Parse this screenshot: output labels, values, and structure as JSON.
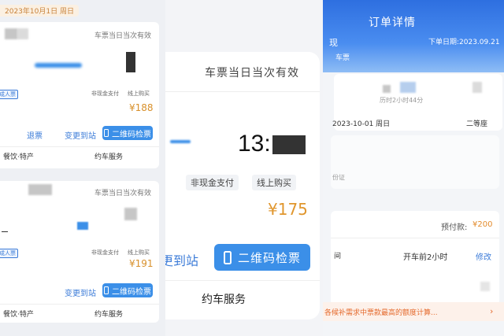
{
  "left": {
    "date": "2023年10月1日 周日",
    "cards": [
      {
        "valid_label": "车票当日当次有效",
        "passenger_type": "成人票",
        "payment": "非现金支付",
        "purchase": "线上购买",
        "price": "¥188",
        "refund": "退票",
        "change_station": "变更到站",
        "qr": "二维码检票",
        "food": "餐饮·特产",
        "ride": "约车服务"
      },
      {
        "valid_label": "车票当日当次有效",
        "passenger_type": "成人票",
        "payment": "非现金支付",
        "purchase": "线上购买",
        "price": "¥191",
        "change_station": "变更到站",
        "qr": "二维码检票",
        "food": "餐饮·特产",
        "ride": "约车服务"
      }
    ]
  },
  "middle": {
    "valid_label": "车票当日当次有效",
    "time_prefix": "13:",
    "payment": "非现金支付",
    "purchase": "线上购买",
    "price": "¥175",
    "change_station": "更到站",
    "qr": "二维码检票",
    "ride": "约车服务"
  },
  "right": {
    "title": "订单详情",
    "order_date": "下单日期:2023.09.21",
    "head_left_1": "现",
    "head_left_2": "车票",
    "duration": "历时2小时44分",
    "travel_date": "2023-10-01 周日",
    "seat_class": "二等座",
    "id_label": "份证",
    "prepay_label": "预付款:",
    "prepay_value": "¥200",
    "row_label": "间",
    "depart_label": "开车前2小时",
    "modify": "修改",
    "notice": "各候补需求中票款最高的额度计算..."
  },
  "colors": {
    "accent_blue": "#3b8fe8",
    "price_orange": "#e0962d",
    "header_blue": "#2e6fe0"
  }
}
